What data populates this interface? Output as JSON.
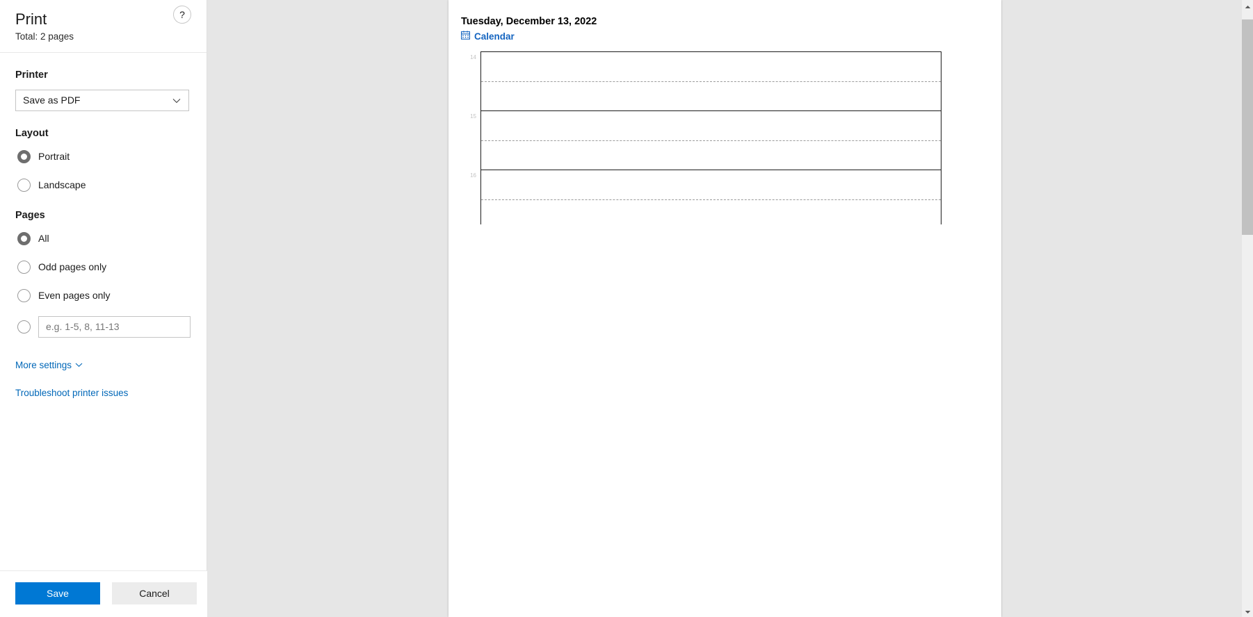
{
  "dialog": {
    "title": "Print",
    "total_pages_text": "Total: 2 pages",
    "help_label": "?",
    "help_icon": "question-mark-icon"
  },
  "printer": {
    "section_label": "Printer",
    "selected": "Save as PDF",
    "chevron_icon": "chevron-down-icon"
  },
  "layout": {
    "section_label": "Layout",
    "options": [
      {
        "label": "Portrait",
        "selected": true
      },
      {
        "label": "Landscape",
        "selected": false
      }
    ]
  },
  "pages": {
    "section_label": "Pages",
    "options": [
      {
        "label": "All",
        "selected": true
      },
      {
        "label": "Odd pages only",
        "selected": false
      },
      {
        "label": "Even pages only",
        "selected": false
      }
    ],
    "custom_range": {
      "selected": false,
      "value": "",
      "placeholder": "e.g. 1-5, 8, 11-13"
    }
  },
  "links": {
    "more_settings": "More settings",
    "more_settings_chevron_icon": "chevron-down-icon",
    "troubleshoot": "Troubleshoot printer issues"
  },
  "footer": {
    "save_label": "Save",
    "cancel_label": "Cancel"
  },
  "preview": {
    "document_title": "Tuesday, December 13, 2022",
    "calendar_label": "Calendar",
    "calendar_icon": "calendar-icon",
    "hours": [
      {
        "label": "14"
      },
      {
        "label": "15"
      },
      {
        "label": "16"
      }
    ]
  },
  "scrollbar": {
    "up_icon": "caret-up-icon",
    "down_icon": "caret-down-icon"
  },
  "colors": {
    "accent": "#0078d4",
    "link": "#0067b8",
    "calendar_link": "#1565c0",
    "page_background": "#e6e6e6",
    "panel_background": "#ffffff"
  }
}
